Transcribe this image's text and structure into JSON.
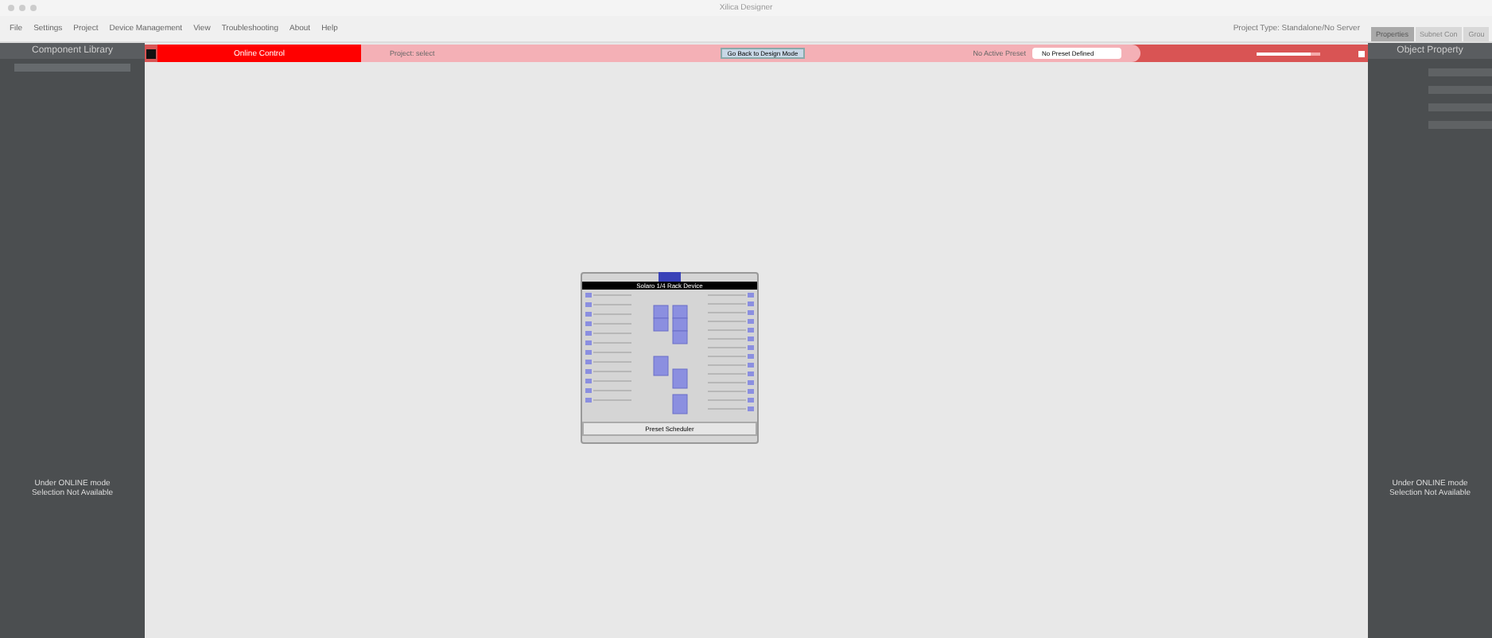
{
  "window": {
    "title": "Xilica Designer"
  },
  "menu": [
    "File",
    "Settings",
    "Project",
    "Device Management",
    "View",
    "Troubleshooting",
    "About",
    "Help"
  ],
  "project_type": "Project Type: Standalone/No Server",
  "left_panel": {
    "title": "Component Library",
    "message": [
      "Under ONLINE mode",
      "Selection Not Available"
    ]
  },
  "toolbar": {
    "mode": "Online Control",
    "project": "Project: select",
    "back_button": "Go Back to Design Mode",
    "preset_label": "No Active Preset",
    "preset": "No Preset Defined",
    "level": 0.85
  },
  "right_panel": {
    "tabs": [
      {
        "label": "Properties",
        "selected": true
      },
      {
        "label": "Subnet Con",
        "selected": false
      },
      {
        "label": "Grou",
        "selected": false
      }
    ],
    "title": "Object Property",
    "message": [
      "Under ONLINE mode",
      "Selection Not Available"
    ]
  },
  "device": {
    "title": "Solaro 1/4 Rack Device",
    "button": "Preset Scheduler"
  }
}
